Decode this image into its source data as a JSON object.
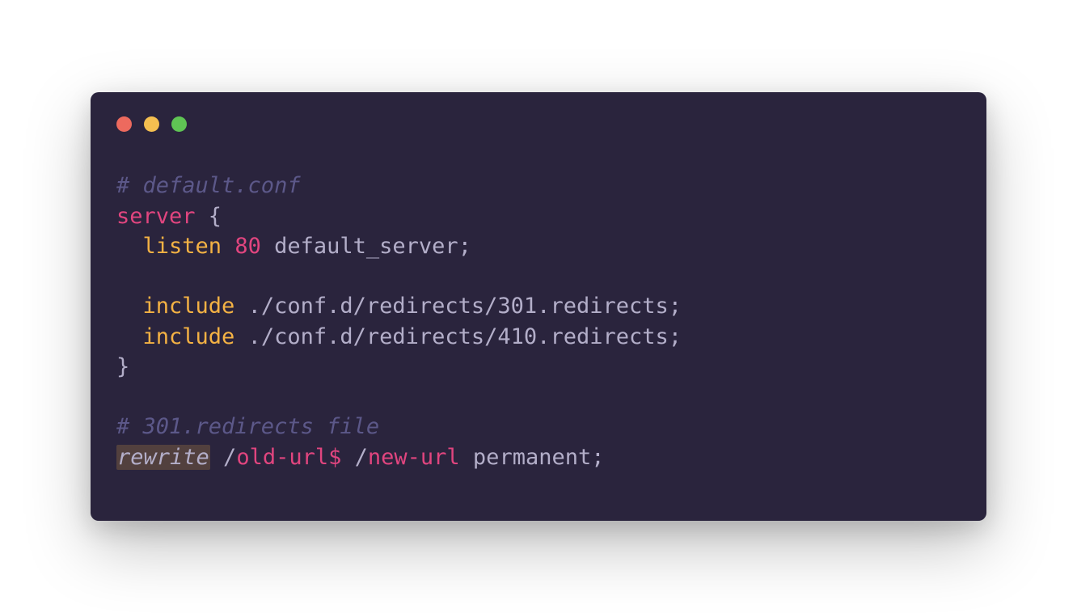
{
  "code": {
    "line1_comment": "# default.conf",
    "line2_server": "server",
    "line2_brace": " {",
    "line3_indent": "  ",
    "line3_listen": "listen",
    "line3_sp1": " ",
    "line3_port": "80",
    "line3_sp2": " ",
    "line3_default": "default_server",
    "line3_semi": ";",
    "line5_indent": "  ",
    "line5_include": "include",
    "line5_path": " ./conf.d/redirects/301.redirects;",
    "line6_indent": "  ",
    "line6_include": "include",
    "line6_path": " ./conf.d/redirects/410.redirects;",
    "line7_brace": "}",
    "line9_comment": "# 301.redirects file",
    "line10_rewrite": "rewrite",
    "line10_sp1": " /",
    "line10_oldurl": "old-url$",
    "line10_sp2": " /",
    "line10_newurl": "new-url",
    "line10_perm": " permanent;"
  }
}
